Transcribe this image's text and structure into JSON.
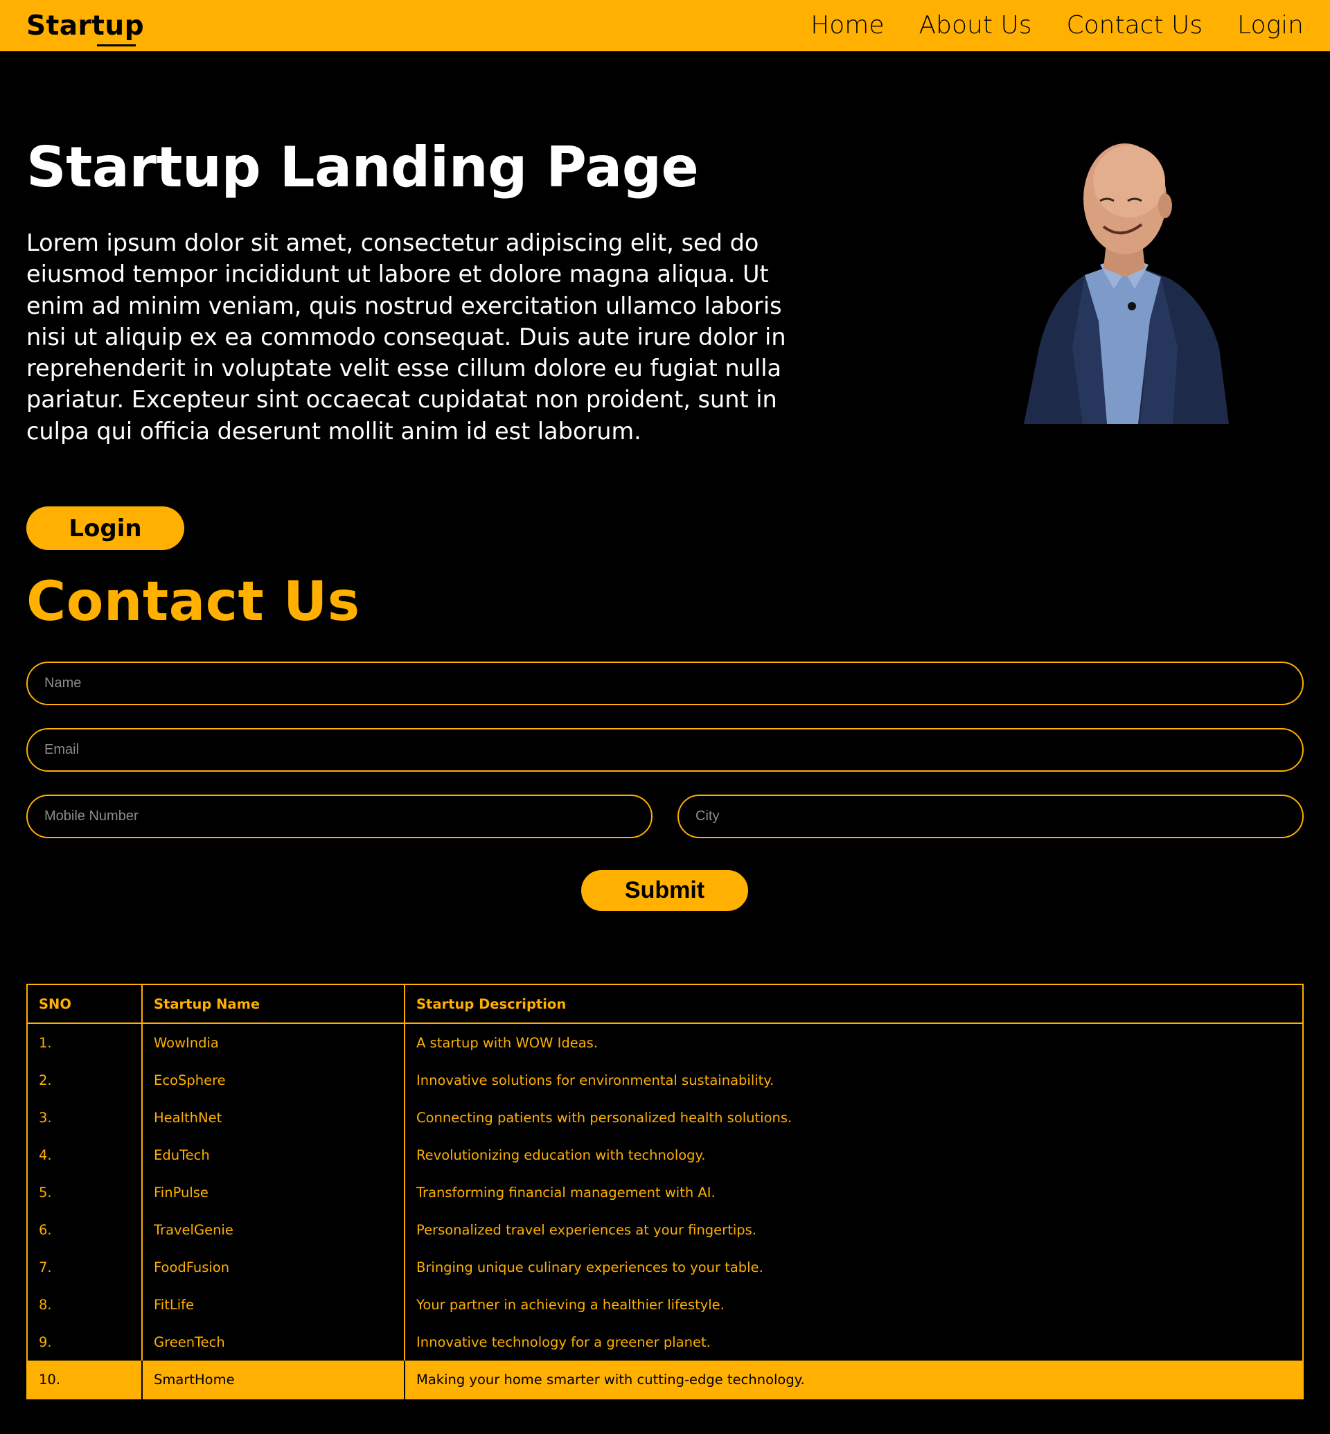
{
  "nav": {
    "logo": "Startup",
    "links": [
      "Home",
      "About Us",
      "Contact Us",
      "Login"
    ]
  },
  "hero": {
    "title": "Startup Landing Page",
    "description": "Lorem ipsum dolor sit amet, consectetur adipiscing elit, sed do eiusmod tempor incididunt ut labore et dolore magna aliqua. Ut enim ad minim veniam, quis nostrud exercitation ullamco laboris nisi ut aliquip ex ea commodo consequat. Duis aute irure dolor in reprehenderit in voluptate velit esse cillum dolore eu fugiat nulla pariatur. Excepteur sint occaecat cupidatat non proident, sunt in culpa qui officia deserunt mollit anim id est laborum.",
    "login_label": "Login"
  },
  "contact": {
    "title": "Contact Us",
    "name_placeholder": "Name",
    "email_placeholder": "Email",
    "mobile_placeholder": "Mobile Number",
    "city_placeholder": "City",
    "submit_label": "Submit"
  },
  "table": {
    "headers": [
      "SNO",
      "Startup Name",
      "Startup Description"
    ],
    "rows": [
      [
        "1.",
        "WowIndia",
        "A startup with WOW Ideas."
      ],
      [
        "2.",
        "EcoSphere",
        "Innovative solutions for environmental sustainability."
      ],
      [
        "3.",
        "HealthNet",
        "Connecting patients with personalized health solutions."
      ],
      [
        "4.",
        "EduTech",
        "Revolutionizing education with technology."
      ],
      [
        "5.",
        "FinPulse",
        "Transforming financial management with AI."
      ],
      [
        "6.",
        "TravelGenie",
        "Personalized travel experiences at your fingertips."
      ],
      [
        "7.",
        "FoodFusion",
        "Bringing unique culinary experiences to your table."
      ],
      [
        "8.",
        "FitLife",
        "Your partner in achieving a healthier lifestyle."
      ],
      [
        "9.",
        "GreenTech",
        "Innovative technology for a greener planet."
      ],
      [
        "10.",
        "SmartHome",
        "Making your home smarter with cutting-edge technology."
      ]
    ]
  },
  "colors": {
    "accent": "#ffb000",
    "background": "#000000"
  }
}
